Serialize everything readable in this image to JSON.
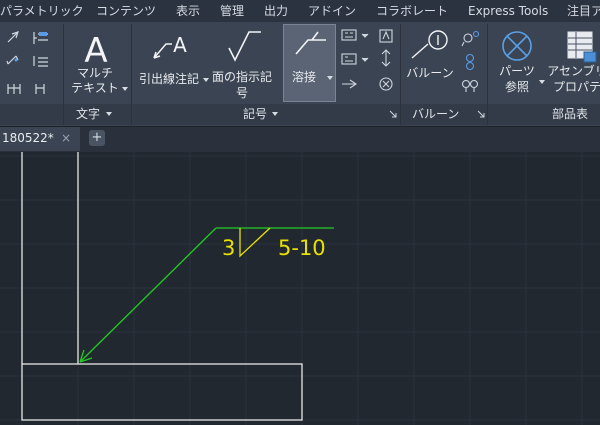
{
  "menu": {
    "items": [
      "パラメトリック",
      "コンテンツ",
      "表示",
      "管理",
      "出力",
      "アドイン",
      "コラボレート",
      "Express Tools",
      "注目ア"
    ]
  },
  "ribbon": {
    "buttons": {
      "mtext": {
        "line1": "マルチ",
        "line2": "テキスト"
      },
      "leader": {
        "label": "引出線注記"
      },
      "surface": {
        "line1": "面の指示記",
        "line2": "号"
      },
      "weld": {
        "label": "溶接"
      },
      "balloon": {
        "label": "バルーン"
      },
      "parts": {
        "line1": "パーツ",
        "line2": "参照"
      },
      "assembly": {
        "line1": "アセンブリ",
        "line2": "プロパテ"
      }
    },
    "panels": {
      "text": "文字",
      "symbol": "記号",
      "balloon": "バルーン",
      "parts_list": "部品表"
    }
  },
  "tab": {
    "label": "180522*",
    "close": "×",
    "add": "+"
  },
  "drawing": {
    "weld_size": "3",
    "weld_length": "5-10",
    "colors": {
      "leader": "#22cc22",
      "text": "#e8e000",
      "geometry": "#e6e6e6",
      "grid": "#2c333d"
    }
  }
}
